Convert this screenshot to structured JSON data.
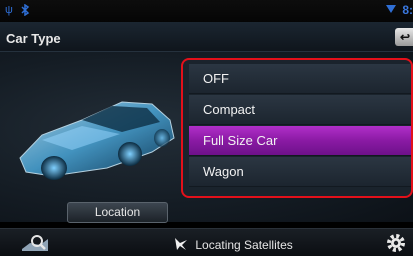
{
  "status_bar": {
    "clock": "8:",
    "icons": [
      "usb-icon",
      "bluetooth-icon",
      "wifi-signal-icon"
    ]
  },
  "header": {
    "title": "Car Type",
    "back_icon": "back-arrow-icon"
  },
  "car_type_options": {
    "items": [
      {
        "label": "OFF",
        "selected": false
      },
      {
        "label": "Compact",
        "selected": false
      },
      {
        "label": "Full Size Car",
        "selected": true
      },
      {
        "label": "Wagon",
        "selected": false
      }
    ],
    "highlight_color": "#e3101a",
    "selected_color": "#9c20b8"
  },
  "location_button": {
    "label": "Location"
  },
  "bottom_bar": {
    "status_text": "Locating Satellites",
    "status_icon": "satellite-icon",
    "left_icon": "map-search-icon",
    "right_icon": "gear-icon"
  }
}
